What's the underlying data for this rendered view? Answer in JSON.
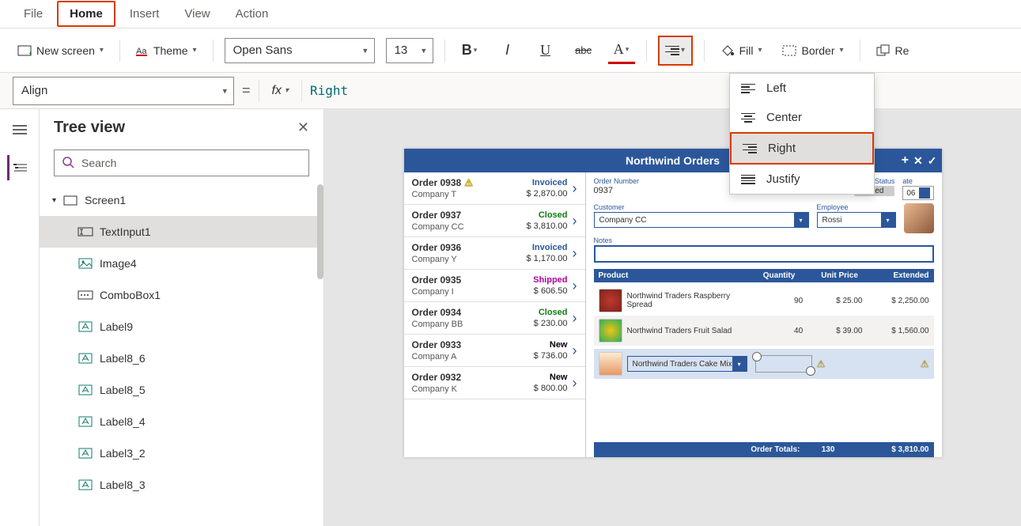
{
  "menubar": {
    "items": [
      "File",
      "Home",
      "Insert",
      "View",
      "Action"
    ],
    "active": "Home"
  },
  "ribbon": {
    "newScreen": "New screen",
    "theme": "Theme",
    "font": "Open Sans",
    "fontSize": "13",
    "fill": "Fill",
    "border": "Border",
    "reorder": "Re"
  },
  "formula": {
    "property": "Align",
    "equals": "=",
    "fx": "fx",
    "value": "Right"
  },
  "alignMenu": {
    "items": [
      "Left",
      "Center",
      "Right",
      "Justify"
    ],
    "selected": "Right"
  },
  "treePanel": {
    "title": "Tree view",
    "searchPlaceholder": "Search",
    "root": "Screen1",
    "nodes": [
      {
        "name": "TextInput1",
        "icon": "textinput",
        "selected": true
      },
      {
        "name": "Image4",
        "icon": "image"
      },
      {
        "name": "ComboBox1",
        "icon": "combo"
      },
      {
        "name": "Label9",
        "icon": "label"
      },
      {
        "name": "Label8_6",
        "icon": "label"
      },
      {
        "name": "Label8_5",
        "icon": "label"
      },
      {
        "name": "Label8_4",
        "icon": "label"
      },
      {
        "name": "Label3_2",
        "icon": "label"
      },
      {
        "name": "Label8_3",
        "icon": "label"
      }
    ]
  },
  "app": {
    "title": "Northwind Orders",
    "orders": [
      {
        "id": "Order 0938",
        "company": "Company T",
        "status": "Invoiced",
        "statusClass": "s-invoiced",
        "amount": "$ 2,870.00",
        "warn": true
      },
      {
        "id": "Order 0937",
        "company": "Company CC",
        "status": "Closed",
        "statusClass": "s-closed",
        "amount": "$ 3,810.00"
      },
      {
        "id": "Order 0936",
        "company": "Company Y",
        "status": "Invoiced",
        "statusClass": "s-invoiced",
        "amount": "$ 1,170.00"
      },
      {
        "id": "Order 0935",
        "company": "Company I",
        "status": "Shipped",
        "statusClass": "s-shipped",
        "amount": "$ 606.50"
      },
      {
        "id": "Order 0934",
        "company": "Company BB",
        "status": "Closed",
        "statusClass": "s-closed",
        "amount": "$ 230.00"
      },
      {
        "id": "Order 0933",
        "company": "Company A",
        "status": "New",
        "statusClass": "s-new",
        "amount": "$ 736.00"
      },
      {
        "id": "Order 0932",
        "company": "Company K",
        "status": "New",
        "statusClass": "s-new",
        "amount": "$ 800.00"
      }
    ],
    "detail": {
      "orderNumberLabel": "Order Number",
      "orderNumber": "0937",
      "orderStatusLabel": "Order Status",
      "orderStatus": "Closed",
      "dateLabel": "ate",
      "dateValue": "06",
      "customerLabel": "Customer",
      "customer": "Company CC",
      "employeeLabel": "Employee",
      "employee": "Rossi",
      "notesLabel": "Notes",
      "productHead": [
        "Product",
        "Quantity",
        "Unit Price",
        "Extended"
      ],
      "products": [
        {
          "name": "Northwind Traders Raspberry Spread",
          "qty": "90",
          "price": "$ 25.00",
          "ext": "$ 2,250.00",
          "thumb": "t1"
        },
        {
          "name": "Northwind Traders Fruit Salad",
          "qty": "40",
          "price": "$ 39.00",
          "ext": "$ 1,560.00",
          "thumb": "t2"
        }
      ],
      "newProduct": "Northwind Traders Cake Mix",
      "totalsLabel": "Order Totals:",
      "totalQty": "130",
      "totalExt": "$ 3,810.00"
    }
  }
}
